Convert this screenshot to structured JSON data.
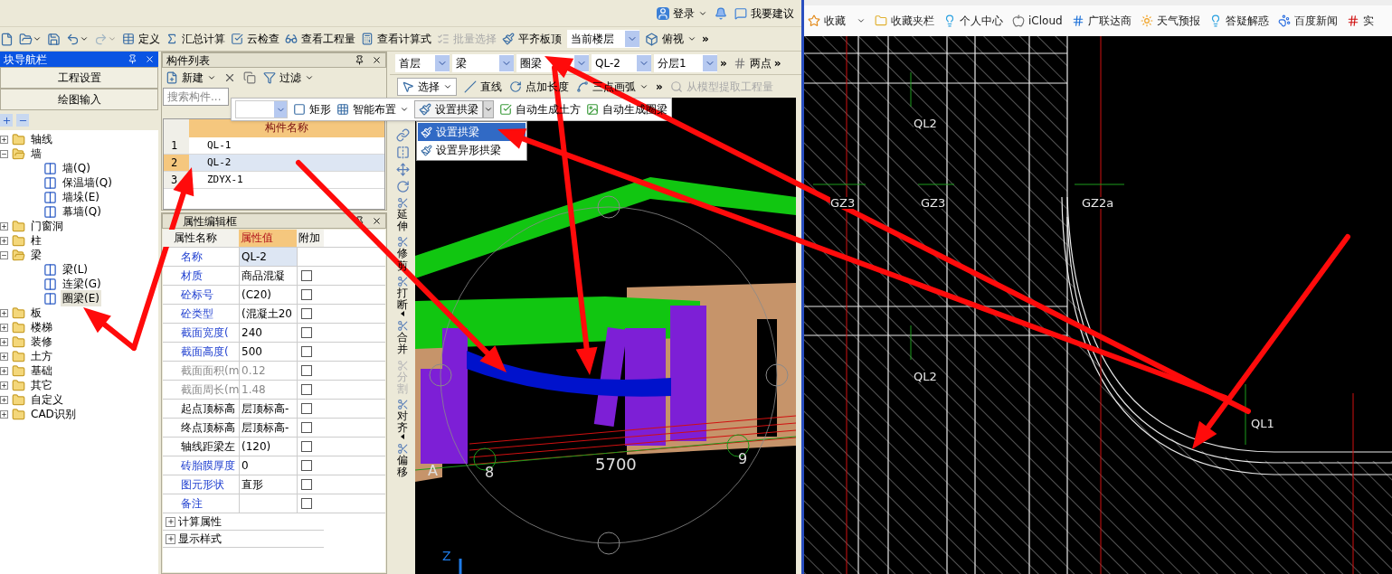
{
  "app": {
    "top_bar": {
      "login": "登录",
      "suggest": "我要建议"
    },
    "quick_tools": [
      {
        "dropdown": false,
        "disabled": false
      },
      {
        "dropdown": true,
        "disabled": false
      },
      {
        "dropdown": false,
        "disabled": false
      },
      {
        "dropdown": true,
        "disabled": false
      },
      {
        "dropdown": true,
        "disabled": true
      }
    ],
    "main_toolbar": [
      {
        "label": "定义",
        "disabled": false
      },
      {
        "label": "汇总计算",
        "disabled": false
      },
      {
        "label": "云检查",
        "disabled": false
      },
      {
        "label": "查看工程量",
        "disabled": false
      },
      {
        "label": "查看计算式",
        "disabled": false
      },
      {
        "label": "批量选择",
        "disabled": true
      },
      {
        "label": "平齐板顶",
        "disabled": false
      }
    ],
    "floor_select": {
      "value": "当前楼层"
    },
    "view_button": {
      "label": "俯视"
    },
    "main_overflow": "»",
    "nav_panel": {
      "title": "块导航栏",
      "buttons": [
        "工程设置",
        "绘图输入"
      ],
      "tree": [
        {
          "label": "轴线",
          "expanded": false,
          "selected": false
        },
        {
          "label": "墙",
          "expanded": true,
          "selected": false,
          "children": [
            {
              "label": "墙(Q)",
              "selected": false
            },
            {
              "label": "保温墙(Q)",
              "selected": false
            },
            {
              "label": "墙垛(E)",
              "selected": false
            },
            {
              "label": "幕墙(Q)",
              "selected": false
            }
          ]
        },
        {
          "label": "门窗洞",
          "expanded": false,
          "selected": false
        },
        {
          "label": "柱",
          "expanded": false,
          "selected": false
        },
        {
          "label": "梁",
          "expanded": true,
          "selected": false,
          "children": [
            {
              "label": "梁(L)",
              "selected": false
            },
            {
              "label": "连梁(G)",
              "selected": false
            },
            {
              "label": "圈梁(E)",
              "selected": true
            }
          ]
        },
        {
          "label": "板",
          "expanded": false,
          "selected": false
        },
        {
          "label": "楼梯",
          "expanded": false,
          "selected": false
        },
        {
          "label": "装修",
          "expanded": false,
          "selected": false
        },
        {
          "label": "土方",
          "expanded": false,
          "selected": false
        },
        {
          "label": "基础",
          "expanded": false,
          "selected": false
        },
        {
          "label": "其它",
          "expanded": false,
          "selected": false
        },
        {
          "label": "自定义",
          "expanded": false,
          "selected": false
        },
        {
          "label": "CAD识别",
          "expanded": false,
          "selected": false
        }
      ]
    },
    "component_list": {
      "title": "构件列表",
      "new_button": "新建",
      "filter_button": "过滤",
      "search": {
        "placeholder": "搜索构件..."
      },
      "column": "构件名称",
      "rows": [
        {
          "index": "1",
          "name": "QL-1",
          "selected": false
        },
        {
          "index": "2",
          "name": "QL-2",
          "selected": true
        },
        {
          "index": "3",
          "name": "ZDYX-1",
          "selected": false
        }
      ]
    },
    "property_panel": {
      "title": "属性编辑框",
      "columns": [
        "属性名称",
        "属性值",
        "附加"
      ],
      "rows": [
        {
          "kind": "public",
          "name": "名称",
          "value": "QL-2",
          "selected": true
        },
        {
          "kind": "public",
          "name": "材质",
          "value": "商品混凝",
          "checked": false,
          "selected": false
        },
        {
          "kind": "public",
          "name": "砼标号",
          "value": "(C20)",
          "checked": false,
          "selected": false
        },
        {
          "kind": "public",
          "name": "砼类型",
          "value": "(混凝土20",
          "checked": false,
          "selected": false
        },
        {
          "kind": "public",
          "name": "截面宽度(",
          "value": "240",
          "checked": false,
          "selected": false
        },
        {
          "kind": "public",
          "name": "截面高度(",
          "value": "500",
          "checked": false,
          "selected": false
        },
        {
          "kind": "readonly",
          "name": "截面面积(m",
          "value": "0.12",
          "checked": false,
          "selected": false
        },
        {
          "kind": "readonly",
          "name": "截面周长(m",
          "value": "1.48",
          "checked": false,
          "selected": false
        },
        {
          "kind": "private",
          "name": "起点顶标高",
          "value": "层顶标高-",
          "checked": false,
          "selected": false
        },
        {
          "kind": "private",
          "name": "终点顶标高",
          "value": "层顶标高-",
          "checked": false,
          "selected": false
        },
        {
          "kind": "private",
          "name": "轴线距梁左",
          "value": "(120)",
          "checked": false,
          "selected": false
        },
        {
          "kind": "public",
          "name": "砖胎膜厚度",
          "value": "0",
          "checked": false,
          "selected": false
        },
        {
          "kind": "public",
          "name": "图元形状",
          "value": "直形",
          "checked": false,
          "selected": false
        },
        {
          "kind": "public",
          "name": "备注",
          "checked": false,
          "selected": false
        },
        {
          "kind": "group",
          "name": "计算属性",
          "expanded": false
        },
        {
          "kind": "group",
          "name": "显示样式",
          "expanded": false
        }
      ]
    },
    "layer_bar": {
      "selects": [
        "首层",
        "梁",
        "圈梁",
        "QL-2",
        "分层1"
      ],
      "overflow": "»",
      "two_point": "两点",
      "overflow_2": "»"
    },
    "draw_bar": {
      "items": [
        {
          "label": "选择",
          "dropdown": true
        },
        {
          "label": "直线",
          "dropdown": false
        },
        {
          "label": "点加长度",
          "dropdown": false
        },
        {
          "label": "三点画弧",
          "dropdown": true
        }
      ],
      "overflow": "»",
      "extract": {
        "label": "从模型提取工程量",
        "disabled": true
      }
    },
    "float_toolbar": {
      "items": [
        {
          "label": "矩形",
          "dropdown": false
        },
        {
          "label": "智能布置",
          "dropdown": true
        }
      ],
      "split": {
        "label": "设置拱梁",
        "open": true
      },
      "items_2": [
        "自动生成土方",
        "自动生成圈梁"
      ],
      "menu": [
        {
          "label": "设置拱梁",
          "selected": true
        },
        {
          "label": "设置异形拱梁",
          "selected": false
        }
      ]
    },
    "side_tools": [
      {
        "kind": "icon"
      },
      {
        "kind": "icon"
      },
      {
        "kind": "icon"
      },
      {
        "kind": "icon"
      },
      {
        "kind": "tool",
        "label": "延伸",
        "disabled": false,
        "dropdown": false
      },
      {
        "kind": "tool",
        "label": "修剪",
        "disabled": false,
        "dropdown": false
      },
      {
        "kind": "tool",
        "label": "打断",
        "disabled": false,
        "dropdown": true
      },
      {
        "kind": "tool",
        "label": "合并",
        "disabled": false,
        "dropdown": false
      },
      {
        "kind": "tool",
        "label": "分割",
        "disabled": true,
        "dropdown": false
      },
      {
        "kind": "tool",
        "label": "对齐",
        "disabled": false,
        "dropdown": true
      },
      {
        "kind": "tool",
        "label": "偏移",
        "disabled": false,
        "dropdown": false
      }
    ],
    "scene_labels": [
      "9",
      "5700",
      "A",
      "8",
      "Z"
    ]
  },
  "browser": {
    "bookmarks": [
      {
        "label": "收藏",
        "dropdown": true
      },
      {
        "label": "收藏夹栏",
        "dropdown": false
      },
      {
        "label": "个人中心",
        "dropdown": false
      },
      {
        "label": "iCloud",
        "dropdown": false
      },
      {
        "label": "广联达商",
        "dropdown": false
      },
      {
        "label": "天气预报",
        "dropdown": false
      },
      {
        "label": "答疑解惑",
        "dropdown": false
      },
      {
        "label": "百度新闻",
        "dropdown": false
      },
      {
        "label": "实",
        "dropdown": false
      }
    ],
    "cad_labels": [
      "QL2",
      "GZ3",
      "GZ3",
      "GZ2a",
      "QL2",
      "QL1"
    ]
  }
}
